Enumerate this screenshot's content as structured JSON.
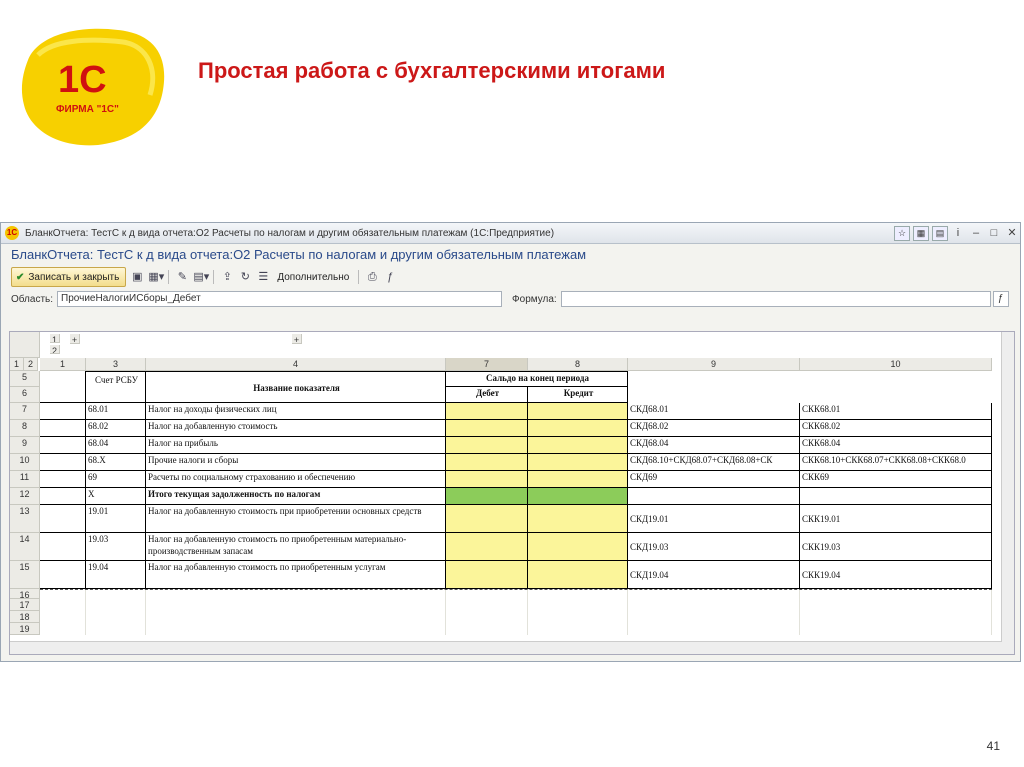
{
  "slide": {
    "logo_text": "1С",
    "logo_sub": "ФИРМА \"1С\"",
    "title": "Простая работа с бухгалтерскими итогами",
    "page_number": "41"
  },
  "window": {
    "title": "БланкОтчета: ТестС к д вида отчета:О2 Расчеты по налогам и другим обязательным платежам  (1С:Предприятие)",
    "heading": "БланкОтчета: ТестС к д вида отчета:О2 Расчеты по налогам и другим обязательным платежам",
    "save_button": "Записать и закрыть",
    "more_button": "Дополнительно",
    "area_label": "Область:",
    "area_value": "ПрочиеНалогиИСборы_Дебет",
    "formula_label": "Формула:",
    "formula_value": ""
  },
  "grid": {
    "columns": [
      "1",
      "3",
      "4",
      "7",
      "8",
      "9",
      "10"
    ],
    "header": {
      "schet": "Счет РСБУ",
      "name": "Название показателя",
      "saldo": "Сальдо на конец периода",
      "debet": "Дебет",
      "kredit": "Кредит"
    },
    "rows": [
      {
        "num": "7",
        "acc": "68.01",
        "name": "Налог на доходы физических лиц",
        "c9": "СКД68.01",
        "c10": "СКК68.01"
      },
      {
        "num": "8",
        "acc": "68.02",
        "name": "Налог на добавленную стоимость",
        "c9": "СКД68.02",
        "c10": "СКК68.02"
      },
      {
        "num": "9",
        "acc": "68.04",
        "name": "Налог на прибыль",
        "c9": "СКД68.04",
        "c10": "СКК68.04"
      },
      {
        "num": "10",
        "acc": "68.X",
        "name": "Прочие налоги и сборы",
        "c9": "СКД68.10+СКД68.07+СКД68.08+СК",
        "c10": "СКК68.10+СКК68.07+СКК68.08+СКК68.0"
      },
      {
        "num": "11",
        "acc": "69",
        "name": "Расчеты по социальному страхованию и обеспечению",
        "c9": "СКД69",
        "c10": "СКК69"
      },
      {
        "num": "12",
        "acc": "X",
        "name": "Итого текущая задолженность по налогам",
        "c9": "",
        "c10": ""
      },
      {
        "num": "13",
        "acc": "19.01",
        "name": "Налог на добавленную стоимость при приобретении основных средств",
        "c9": "СКД19.01",
        "c10": "СКК19.01"
      },
      {
        "num": "14",
        "acc": "19.03",
        "name": "Налог на добавленную стоимость по приобретенным материально-производственным запасам",
        "c9": "СКД19.03",
        "c10": "СКК19.03"
      },
      {
        "num": "15",
        "acc": "19.04",
        "name": "Налог на добавленную стоимость по приобретенным услугам",
        "c9": "СКД19.04",
        "c10": "СКК19.04"
      }
    ],
    "row_numbers_top": [
      "5",
      "6"
    ],
    "row_numbers_bottom": [
      "16",
      "17",
      "18",
      "19"
    ],
    "group_labels": [
      "1",
      "2"
    ]
  }
}
